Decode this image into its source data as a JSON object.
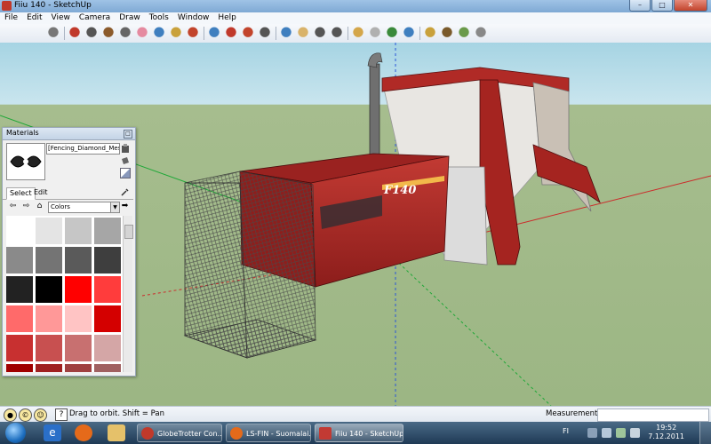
{
  "window": {
    "title": "Fiiu 140 - SketchUp",
    "minimize": "–",
    "maximize": "□",
    "close": "✕"
  },
  "menu": [
    "File",
    "Edit",
    "View",
    "Camera",
    "Draw",
    "Tools",
    "Window",
    "Help"
  ],
  "toolbar": {
    "icons": [
      "select-arrow-icon",
      "pencil-line-icon",
      "rectangle-icon",
      "circle-icon",
      "arc-icon",
      "eraser-icon",
      "paint-bucket-icon",
      "push-pull-icon",
      "follow-me-icon",
      "move-icon",
      "rotate-icon",
      "offset-icon",
      "scale-icon",
      "orbit-icon",
      "pan-icon",
      "zoom-icon",
      "zoom-extents-icon",
      "section-plane-icon",
      "get-models-icon",
      "share-model-icon",
      "google-earth-icon",
      "components-icon",
      "add-location-icon",
      "toggle-terrain-icon",
      "get-photo-icon"
    ]
  },
  "viewport": {
    "model_badge": "F140",
    "colors": {
      "sky": "#a6d4e3",
      "ground": "#9cb684",
      "body_red": "#b02a26",
      "axis_red": "#cc2a2a",
      "axis_green": "#1fa838",
      "axis_blue": "#2a55d8"
    }
  },
  "materials": {
    "title": "Materials",
    "close": "□",
    "name_value": "[Fencing_Diamond_Mesh",
    "tabs": [
      "Select",
      "Edit"
    ],
    "active_tab": "Select",
    "library": "Colors",
    "swatches": [
      "#ffffff",
      "#e4e4e4",
      "#c6c6c6",
      "#a6a6a6",
      "#8a8a8a",
      "#747474",
      "#5a5a5a",
      "#3e3e3e",
      "#222222",
      "#000000",
      "#ff0000",
      "#ff3c3c",
      "#ff6a6a",
      "#ff9898",
      "#ffc4c4",
      "#d40000",
      "#c83030",
      "#c85050",
      "#c87070",
      "#d4a6a6",
      "#a00000",
      "#a02020",
      "#a04040",
      "#a06060"
    ]
  },
  "status": {
    "hint": "Drag to orbit.  Shift = Pan",
    "measurements_label": "Measurements",
    "measurements_value": ""
  },
  "taskbar": {
    "tasks": [
      "GlobeTrotter Con...",
      "LS-FIN - Suomalai...",
      "Fiiu 140 - SketchUp"
    ],
    "active_task": "Fiiu 140 - SketchUp",
    "language": "FI",
    "time": "19:52",
    "date": "7.12.2011"
  }
}
